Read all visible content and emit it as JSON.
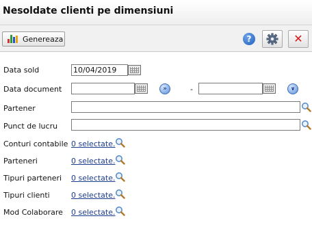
{
  "title": "Nesoldate clienti pe dimensiuni",
  "toolbar": {
    "generate_label": "Genereaza",
    "help_symbol": "?",
    "close_symbol": "✕",
    "chart_icon_colors": [
      "#d62f2f",
      "#2e9b3a",
      "#1f58c4",
      "#e8a317"
    ]
  },
  "form": {
    "data_sold": {
      "label": "Data sold",
      "value": "10/04/2019"
    },
    "data_document": {
      "label": "Data document",
      "from_value": "",
      "to_value": "",
      "separator": "-"
    },
    "partener": {
      "label": "Partener",
      "value": ""
    },
    "punct_de_lucru": {
      "label": "Punct de lucru",
      "value": ""
    },
    "conturi_contabile": {
      "label": "Conturi contabile",
      "link": "0 selectate."
    },
    "parteneri": {
      "label": "Parteneri",
      "link": "0 selectate."
    },
    "tipuri_parteneri": {
      "label": "Tipuri parteneri",
      "link": "0 selectate."
    },
    "tipuri_clienti": {
      "label": "Tipuri clienti",
      "link": "0 selectate."
    },
    "mod_colaborare": {
      "label": "Mod Colaborare",
      "link": "0 selectate."
    }
  },
  "colors": {
    "link": "#1a3c8c",
    "close": "#d51616",
    "help": "#1d5fbf"
  }
}
